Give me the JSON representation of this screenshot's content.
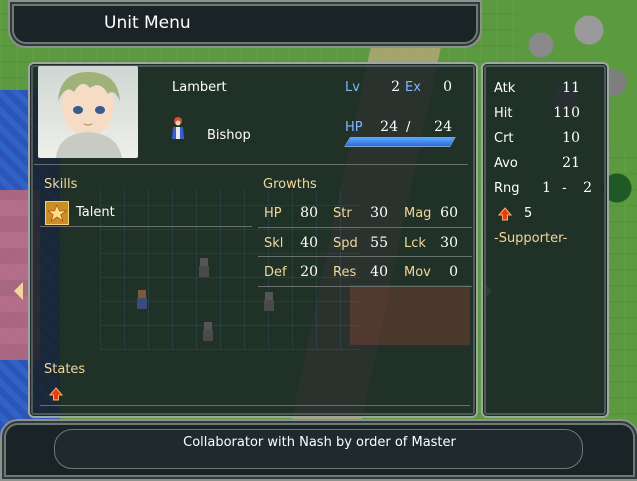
{
  "header": {
    "title": "Unit Menu"
  },
  "unit": {
    "name": "Lambert",
    "class": "Bishop",
    "lv_label": "Lv",
    "lv": "2",
    "ex_label": "Ex",
    "ex": "0",
    "hp_label": "HP",
    "hp": "24",
    "hp_sep": "/",
    "hp_max": "24",
    "hp_fraction": 1.0
  },
  "skills": {
    "heading": "Skills",
    "items": [
      {
        "name": "Talent",
        "icon": "talent-star-icon"
      }
    ]
  },
  "growths": {
    "heading": "Growths",
    "rows": [
      [
        {
          "label": "HP",
          "value": "80"
        },
        {
          "label": "Str",
          "value": "30"
        },
        {
          "label": "Mag",
          "value": "60"
        }
      ],
      [
        {
          "label": "Skl",
          "value": "40"
        },
        {
          "label": "Spd",
          "value": "55"
        },
        {
          "label": "Lck",
          "value": "30"
        }
      ],
      [
        {
          "label": "Def",
          "value": "20"
        },
        {
          "label": "Res",
          "value": "40"
        },
        {
          "label": "Mov",
          "value": "0"
        }
      ]
    ]
  },
  "states": {
    "heading": "States",
    "icon": "red-up-arrow-icon"
  },
  "combat": {
    "atk_label": "Atk",
    "atk": "11",
    "hit_label": "Hit",
    "hit": "110",
    "crt_label": "Crt",
    "crt": "10",
    "avo_label": "Avo",
    "avo": "21",
    "rng_label": "Rng",
    "rng_min": "1",
    "rng_sep": "-",
    "rng_max": "2",
    "buff_value": "5",
    "role": "-Supporter-"
  },
  "footer": {
    "description": "Collaborator with Nash by order of Master"
  },
  "colors": {
    "label_blue": "#7fb8ff",
    "heading_tan": "#f2d79a",
    "hp_bar": "#3a86f0"
  }
}
